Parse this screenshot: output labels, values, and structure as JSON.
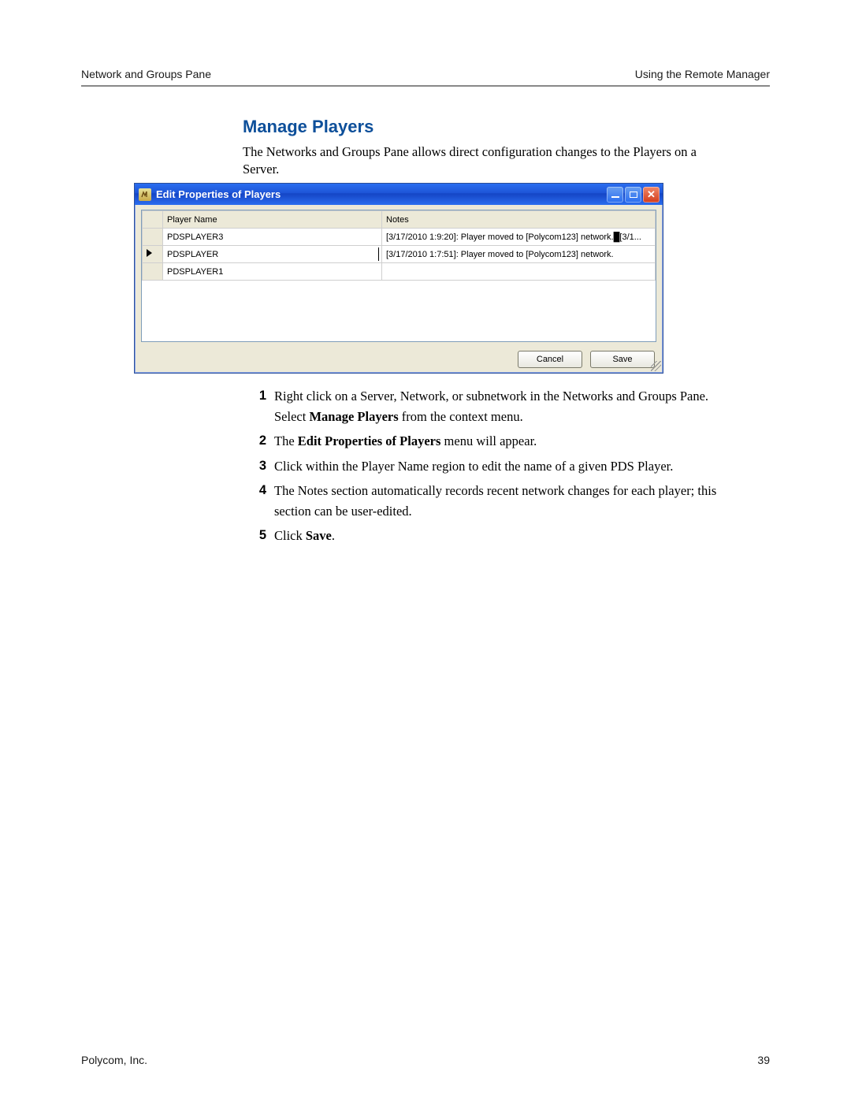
{
  "header": {
    "left": "Network and Groups Pane",
    "right": "Using the Remote Manager"
  },
  "section_title": "Manage Players",
  "intro": "The Networks and Groups Pane allows direct configuration changes to the Players on a Server.",
  "dialog": {
    "title": "Edit Properties of Players",
    "columns": {
      "player_name": "Player Name",
      "notes": "Notes"
    },
    "rows": [
      {
        "selected": false,
        "editing": false,
        "name": "PDSPLAYER3",
        "notes": "[3/17/2010 1:9:20]: Player moved to [Polycom123] network.█[3/1..."
      },
      {
        "selected": true,
        "editing": true,
        "name": "PDSPLAYER",
        "notes": "[3/17/2010 1:7:51]: Player moved to [Polycom123] network."
      },
      {
        "selected": false,
        "editing": false,
        "name": "PDSPLAYER1",
        "notes": ""
      }
    ],
    "cancel": "Cancel",
    "save": "Save"
  },
  "steps": [
    {
      "n": "1",
      "t1": "Right click on a Server, Network, or subnetwork in the Networks and Groups Pane. Select ",
      "b1": "Manage Players",
      "t2": " from the context menu."
    },
    {
      "n": "2",
      "t1": "The ",
      "b1": "Edit Properties of Players",
      "t2": " menu will appear."
    },
    {
      "n": "3",
      "t1": "Click within the Player Name region to edit the name of a given PDS Player.",
      "b1": "",
      "t2": ""
    },
    {
      "n": "4",
      "t1": "The Notes section automatically records recent network changes for each player; this section can be user-edited.",
      "b1": "",
      "t2": ""
    },
    {
      "n": "5",
      "t1": "Click ",
      "b1": "Save",
      "t2": "."
    }
  ],
  "footer": {
    "left": "Polycom, Inc.",
    "right": "39"
  }
}
